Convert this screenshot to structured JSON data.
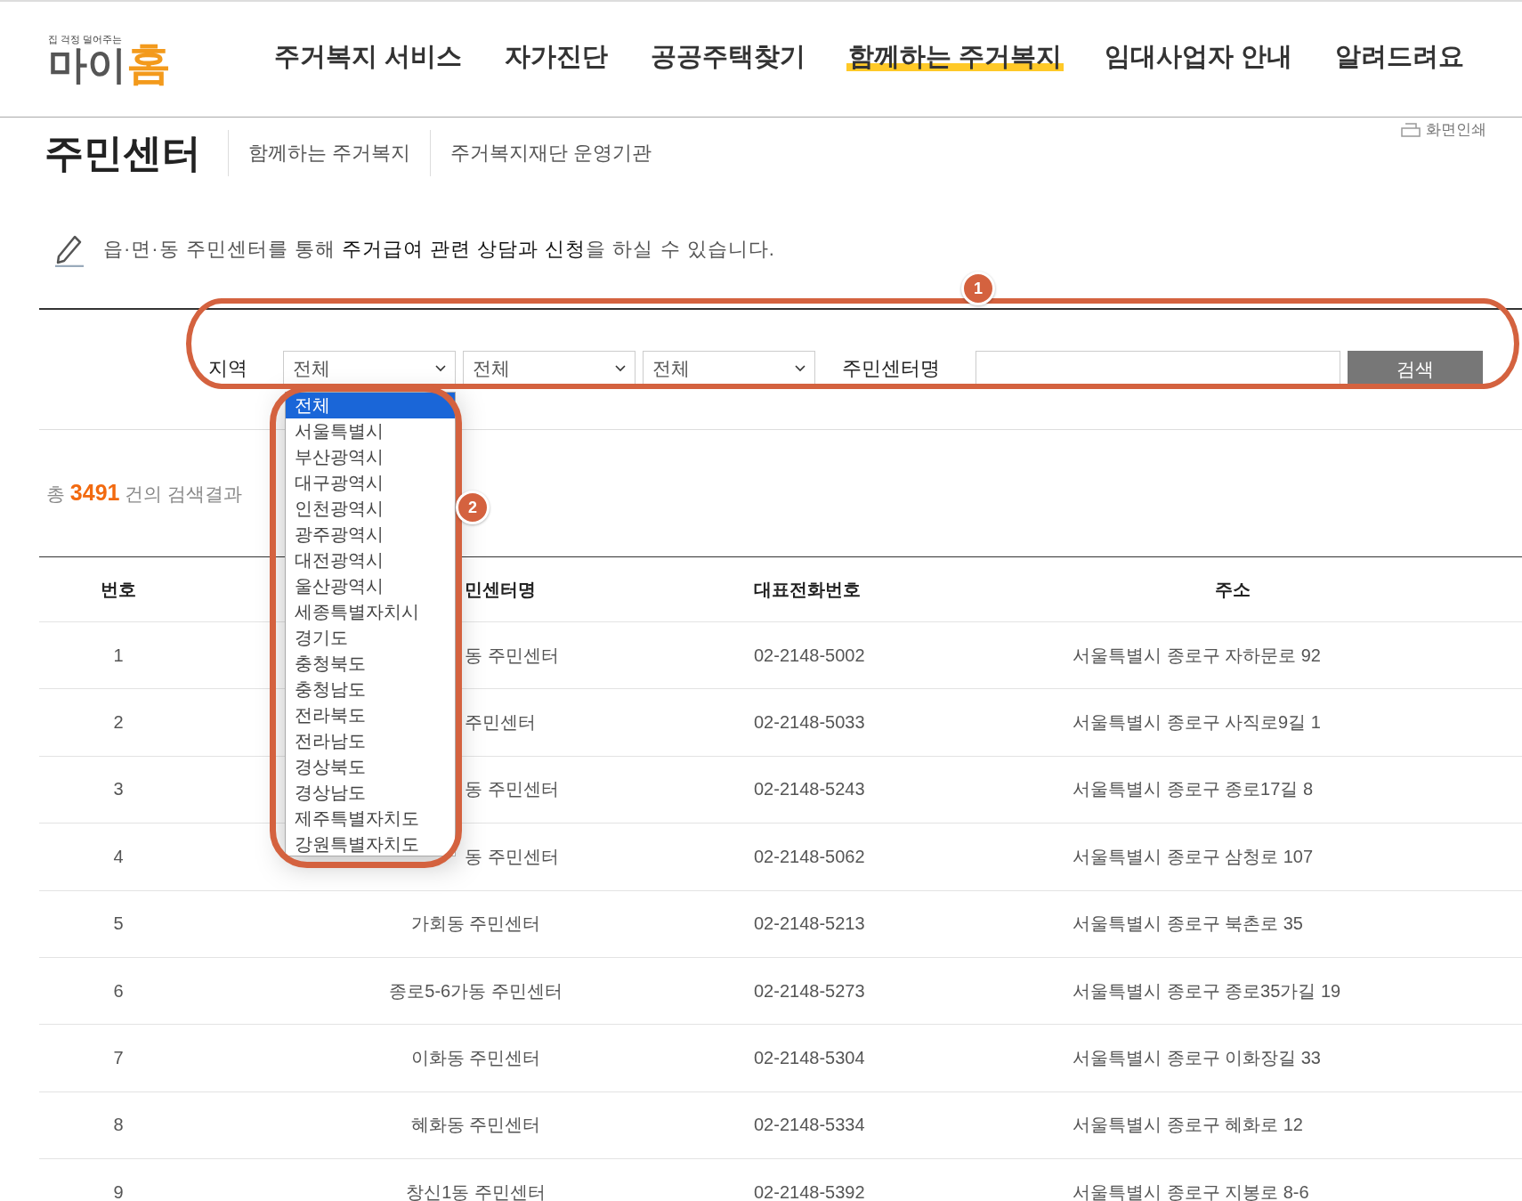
{
  "header": {
    "logo": {
      "tagline": "집 걱정 덜어주는",
      "name_main": "마이",
      "name_accent": "홈"
    },
    "nav": [
      {
        "label": "주거복지 서비스",
        "selected": false
      },
      {
        "label": "자가진단",
        "selected": false
      },
      {
        "label": "공공주택찾기",
        "selected": false
      },
      {
        "label": "함께하는 주거복지",
        "selected": true
      },
      {
        "label": "임대사업자 안내",
        "selected": false
      },
      {
        "label": "알려드려요",
        "selected": false
      }
    ]
  },
  "page": {
    "title": "주민센터",
    "tabs": [
      "함께하는 주거복지",
      "주거복지재단 운영기관"
    ],
    "print": "화면인쇄"
  },
  "notice": "읍·면·동 주민센터를 통해 **주거급여 관련 상담과 신청**을 하실 수 있습니다.",
  "search": {
    "region_label": "지역",
    "selects": [
      "전체",
      "전체",
      "전체"
    ],
    "name_label": "주민센터명",
    "button": "검색"
  },
  "dropdown": {
    "options": [
      {
        "label": "전체",
        "selected": true
      },
      {
        "label": "서울특별시",
        "selected": false
      },
      {
        "label": "부산광역시",
        "selected": false
      },
      {
        "label": "대구광역시",
        "selected": false
      },
      {
        "label": "인천광역시",
        "selected": false
      },
      {
        "label": "광주광역시",
        "selected": false
      },
      {
        "label": "대전광역시",
        "selected": false
      },
      {
        "label": "울산광역시",
        "selected": false
      },
      {
        "label": "세종특별자치시",
        "selected": false
      },
      {
        "label": "경기도",
        "selected": false
      },
      {
        "label": "충청북도",
        "selected": false
      },
      {
        "label": "충청남도",
        "selected": false
      },
      {
        "label": "전라북도",
        "selected": false
      },
      {
        "label": "전라남도",
        "selected": false
      },
      {
        "label": "경상북도",
        "selected": false
      },
      {
        "label": "경상남도",
        "selected": false
      },
      {
        "label": "제주특별자치도",
        "selected": false
      },
      {
        "label": "강원특별자치도",
        "selected": false
      }
    ]
  },
  "result_count": "총 **3491** 건의 검색결과",
  "table": {
    "columns": [
      {
        "label": "번호",
        "covered": false
      },
      {
        "label": "민센터명",
        "covered": true
      },
      {
        "label": "대표전화번호",
        "covered": false
      },
      {
        "label": "주소",
        "covered": false
      }
    ],
    "rows": [
      {
        "number": "1",
        "name": "동 주민센터",
        "name_covered": true,
        "phone": "02-2148-5002",
        "address": "서울특별시 종로구 자하문로 92"
      },
      {
        "number": "2",
        "name": "주민센터",
        "name_covered": true,
        "phone": "02-2148-5033",
        "address": "서울특별시 종로구 사직로9길 1"
      },
      {
        "number": "3",
        "name": "동 주민센터",
        "name_covered": true,
        "phone": "02-2148-5243",
        "address": "서울특별시 종로구 종로17길 8"
      },
      {
        "number": "4",
        "name": "동 주민센터",
        "name_covered": true,
        "phone": "02-2148-5062",
        "address": "서울특별시 종로구 삼청로 107"
      },
      {
        "number": "5",
        "name": "가회동 주민센터",
        "name_covered": false,
        "phone": "02-2148-5213",
        "address": "서울특별시 종로구 북촌로 35"
      },
      {
        "number": "6",
        "name": "종로5-6가동 주민센터",
        "name_covered": false,
        "phone": "02-2148-5273",
        "address": "서울특별시 종로구 종로35가길 19"
      },
      {
        "number": "7",
        "name": "이화동 주민센터",
        "name_covered": false,
        "phone": "02-2148-5304",
        "address": "서울특별시 종로구 이화장길 33"
      },
      {
        "number": "8",
        "name": "혜화동 주민센터",
        "name_covered": false,
        "phone": "02-2148-5334",
        "address": "서울특별시 종로구 혜화로 12"
      },
      {
        "number": "9",
        "name": "창신1동 주민센터",
        "name_covered": false,
        "phone": "02-2148-5392",
        "address": "서울특별시 종로구 지봉로 8-6"
      }
    ]
  },
  "annotations": [
    {
      "kind": "ellipse",
      "label": "1"
    },
    {
      "kind": "box",
      "label": "2"
    }
  ]
}
